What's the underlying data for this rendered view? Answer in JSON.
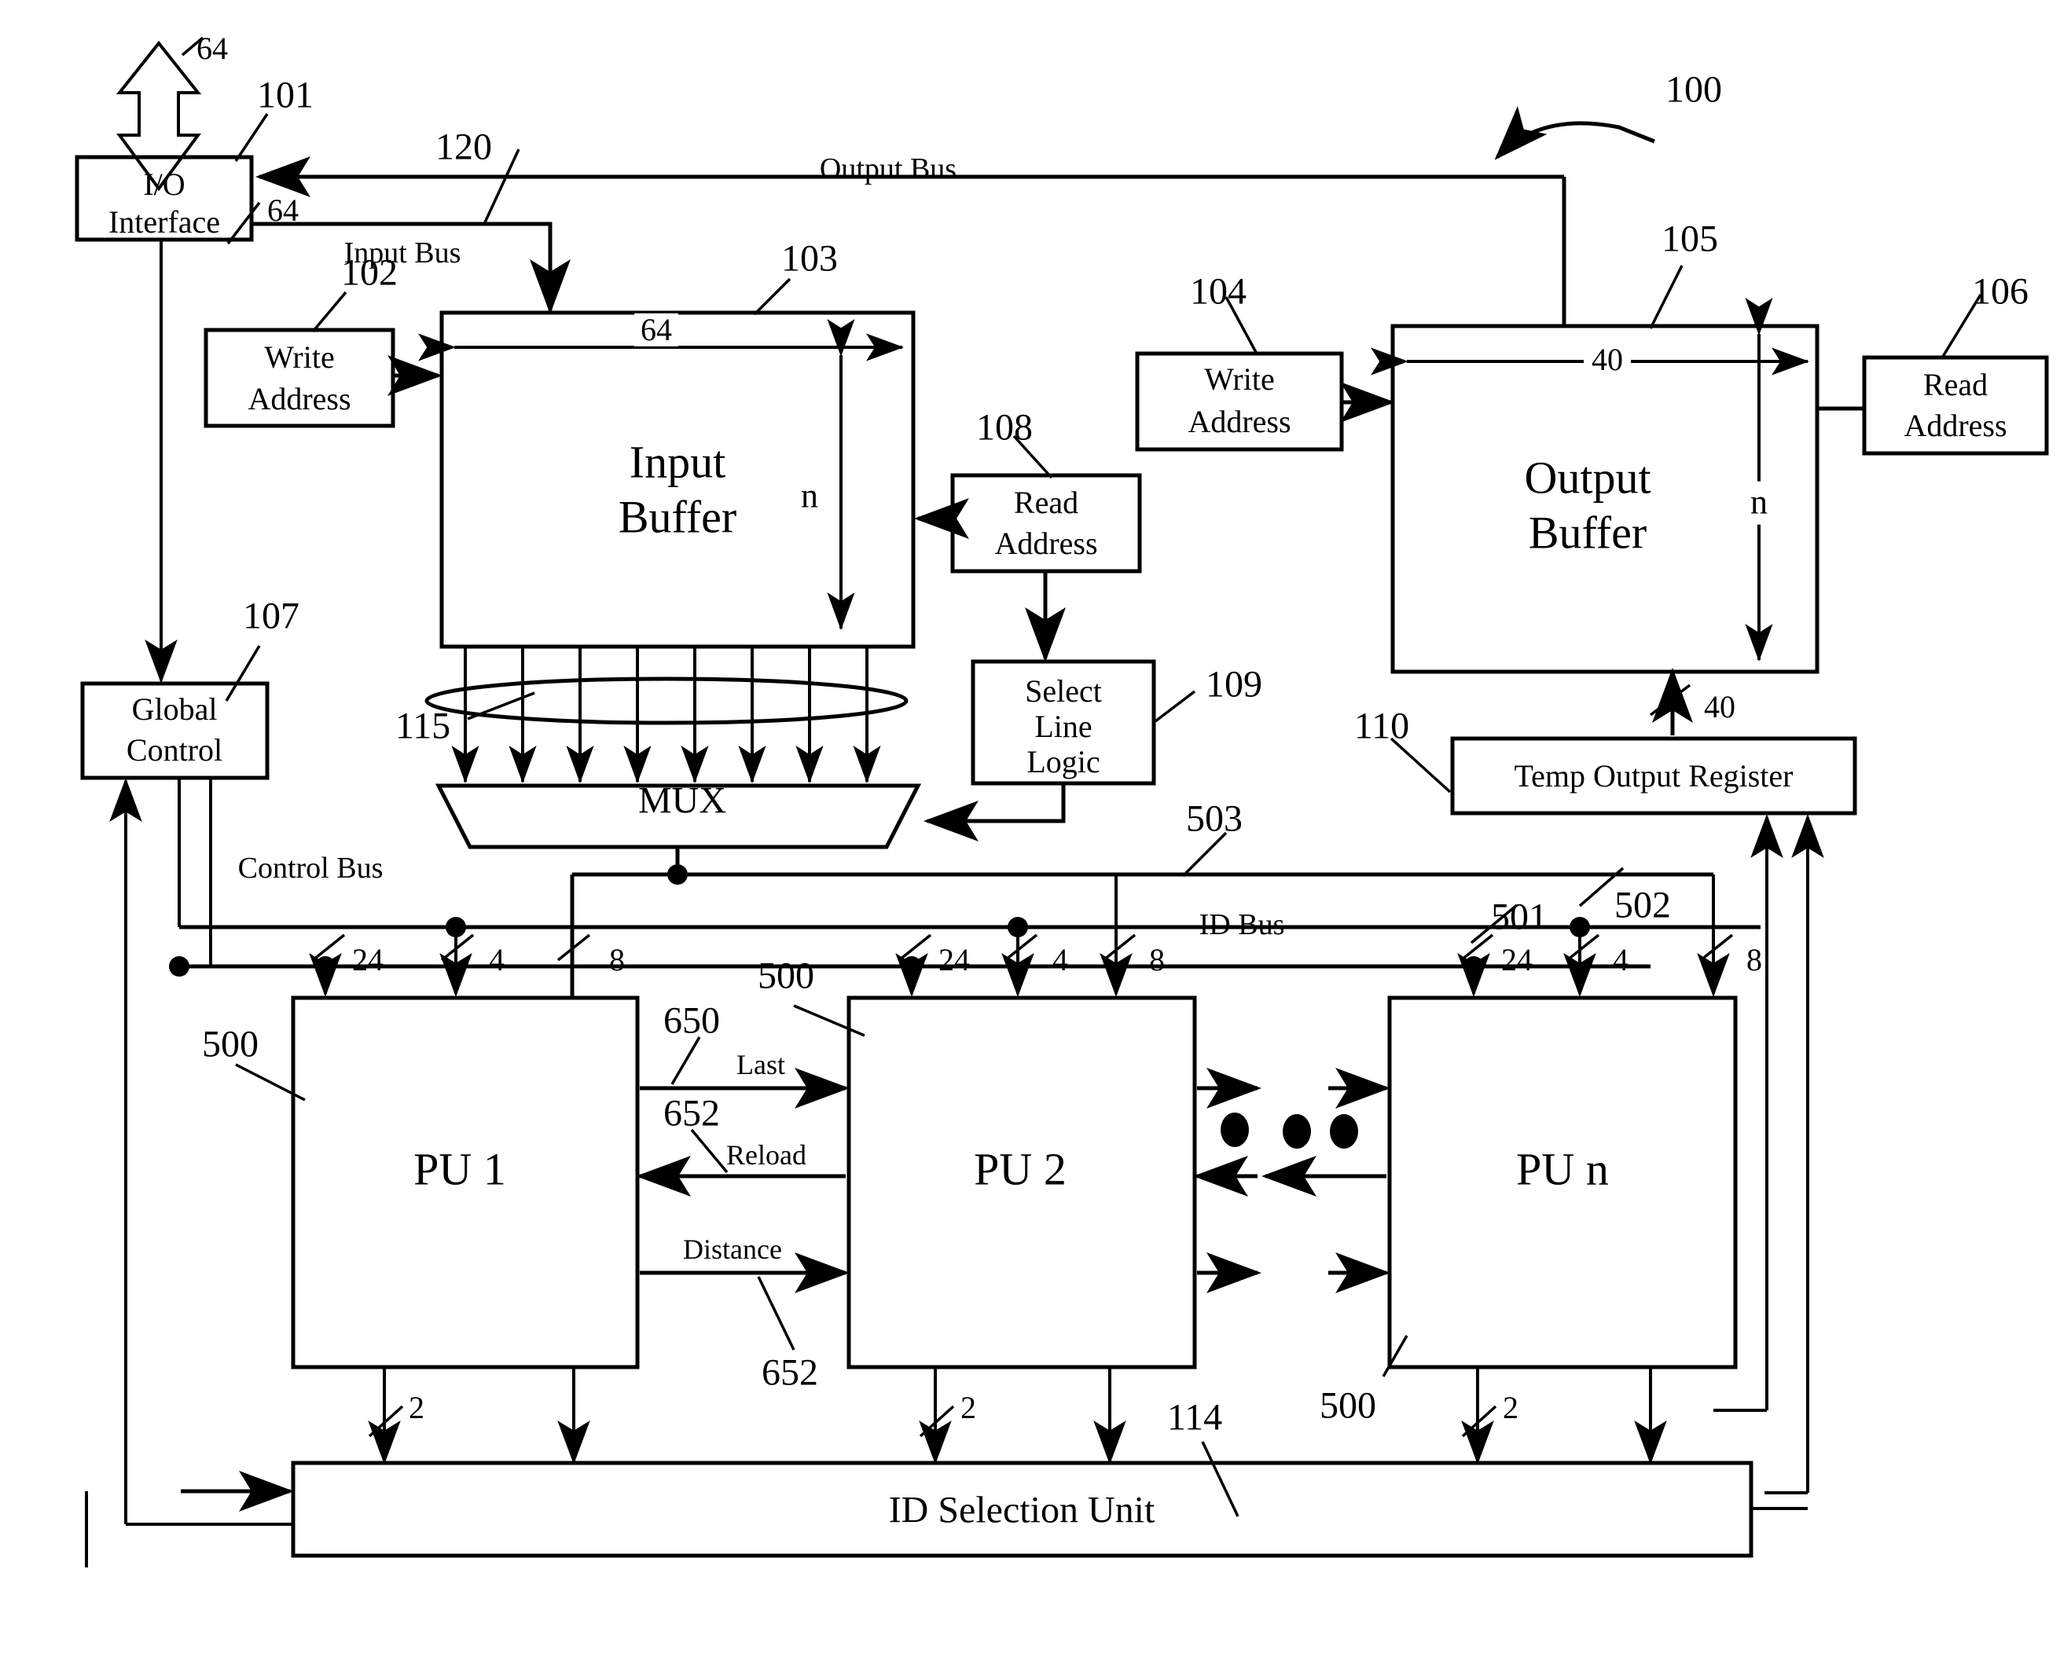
{
  "figure": {
    "reference_numerals": {
      "system": "100",
      "io_interface": "101",
      "input_write_address": "102",
      "input_buffer": "103",
      "output_write_address": "104",
      "output_buffer": "105",
      "output_read_address": "106",
      "global_control": "107",
      "input_read_address": "108",
      "select_line_logic": "109",
      "temp_output_register": "110",
      "id_selection_unit": "114",
      "mux_select_lines": "115",
      "input_bus_ref": "120",
      "pu_block_a": "500",
      "pu_block_b": "500",
      "pu_block_c": "500",
      "id_bus_branch_1": "501",
      "id_bus_branch_2": "502",
      "control_bus_branch": "503",
      "last_signal": "650",
      "reload_signal": "652",
      "distance_signal": "652"
    },
    "blocks": {
      "io_interface": "I/O\nInterface",
      "io_interface_line1": "I/O",
      "io_interface_line2": "Interface",
      "write_address_input": "Write\nAddress",
      "write_address_input_l1": "Write",
      "write_address_input_l2": "Address",
      "input_buffer_l1": "Input",
      "input_buffer_l2": "Buffer",
      "read_address_input_l1": "Read",
      "read_address_input_l2": "Address",
      "select_line_logic_l1": "Select",
      "select_line_logic_l2": "Line",
      "select_line_logic_l3": "Logic",
      "write_address_output_l1": "Write",
      "write_address_output_l2": "Address",
      "output_buffer_l1": "Output",
      "output_buffer_l2": "Buffer",
      "read_address_output_l1": "Read",
      "read_address_output_l2": "Address",
      "global_control_l1": "Global",
      "global_control_l2": "Control",
      "temp_output_register": "Temp Output Register",
      "mux": "MUX",
      "pu1": "PU 1",
      "pu2": "PU 2",
      "pun": "PU n",
      "id_selection_unit": "ID Selection Unit"
    },
    "bus_labels": {
      "output_bus": "Output Bus",
      "input_bus": "Input Bus",
      "control_bus": "Control Bus",
      "id_bus": "ID Bus"
    },
    "signals": {
      "last": "Last",
      "reload": "Reload",
      "distance": "Distance"
    },
    "bit_widths": {
      "io_external": "64",
      "io_to_input_bus": "64",
      "input_buffer_width": "64",
      "input_buffer_depth": "n",
      "output_buffer_width": "40",
      "output_buffer_depth": "n",
      "temp_output_to_buffer": "40",
      "pu1_a": "24",
      "pu1_b": "4",
      "pu1_c": "8",
      "pu2_a": "24",
      "pu2_b": "4",
      "pu2_c": "8",
      "pun_a": "24",
      "pun_b": "4",
      "pun_c": "8",
      "pu1_out": "2",
      "pu2_out": "2",
      "pun_out": "2"
    },
    "colors": {
      "line": "#000000",
      "background": "#ffffff"
    }
  }
}
